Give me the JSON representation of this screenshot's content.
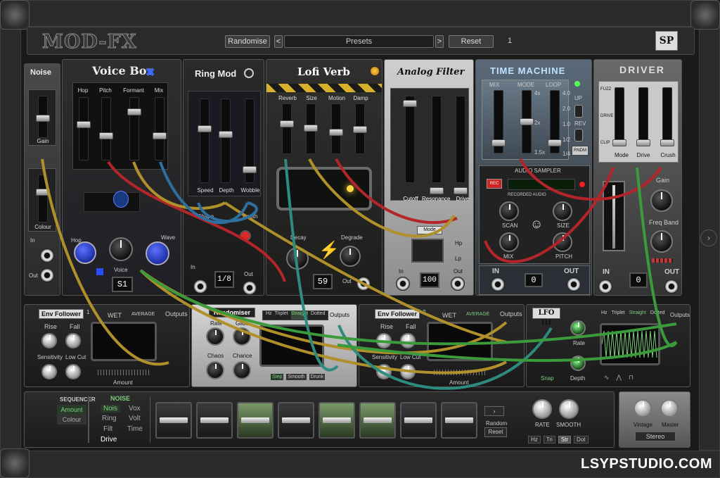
{
  "topbar": {
    "logo": "MOD-FX",
    "randomise_label": "Randomise",
    "preset_prev": "<",
    "preset_label": "Presets",
    "preset_next": ">",
    "reset_label": "Reset",
    "indicator": "1",
    "brand": "SP"
  },
  "noise": {
    "title": "Noise",
    "gain": "Gain",
    "colour": "Colour",
    "in": "In",
    "out": "Out"
  },
  "voicebox": {
    "title": "Voice Box",
    "sliders": [
      "Hop",
      "Pitch",
      "Formant",
      "Mix"
    ],
    "knob_voice": "Voice",
    "knob_wave": "Wave",
    "display": "S1"
  },
  "ringmod": {
    "title": "Ring Mod",
    "sliders": [
      "Speed",
      "Depth",
      "Wobble"
    ],
    "labels": [
      "Shape",
      "Depth"
    ],
    "display": "1/8",
    "in": "In",
    "out": "Out"
  },
  "lofiverb": {
    "title": "Lofi Verb",
    "sliders": [
      "Reverb",
      "Size",
      "Motion",
      "Damp"
    ],
    "knob_decay": "Decay",
    "knob_degrade": "Degrade",
    "display": "59",
    "out": "Out"
  },
  "analogfilter": {
    "title": "Analog Filter",
    "sliders": [
      "Cutoff",
      "Resonance",
      "Drive"
    ],
    "mode": "Mode",
    "hp": "Hp",
    "lp": "Lp",
    "display": "100",
    "in": "In",
    "out": "Out"
  },
  "timemachine": {
    "title": "TIME MACHINE",
    "cols": [
      "MIX",
      "MODE",
      "LOOP"
    ],
    "mode_vals": [
      "4x",
      "2x",
      "1.5x"
    ],
    "loop_vals": [
      "4.0",
      "2.0",
      "1.0",
      "1/2",
      "1/4"
    ],
    "switches": [
      "UP",
      "REV",
      "RNDM"
    ],
    "sampler": "AUDIO SAMPLER",
    "rec": "REC",
    "recorded": "RECORDED AUDIO",
    "knobs": [
      "SCAN",
      "SIZE",
      "MIX",
      "PITCH"
    ],
    "in": "IN",
    "out": "OUT",
    "display": "0"
  },
  "driver": {
    "title": "DRIVER",
    "sliders": [
      "Mode",
      "Drive",
      "Crush"
    ],
    "side": [
      "FUZZ",
      "DRIVE",
      "CLIP"
    ],
    "gain": "Gain",
    "freqband": "Freq Band",
    "in": "IN",
    "out": "OUT",
    "display": "0"
  },
  "envfollower1": {
    "title": "Env Follower",
    "num": "1",
    "wet": "WET",
    "average": "AVERAGE",
    "outputs": "Outputs",
    "rise": "Rise",
    "fall": "Fall",
    "sensitivity": "Sensitivity",
    "lowcut": "Low Cut",
    "amount": "Amount"
  },
  "randomiser": {
    "title": "Randomiser",
    "tabs": [
      "Hz",
      "Triplet",
      "Straight",
      "Dotted"
    ],
    "rate": "Rate",
    "glide": "Glide",
    "chaos": "Chaos",
    "chance": "Chance",
    "modes": [
      "Step",
      "Smooth",
      "Drunk"
    ],
    "outputs": "Outputs"
  },
  "envfollower2": {
    "title": "Env Follower",
    "num": "2",
    "wet": "WET",
    "average": "AVERAGE",
    "outputs": "Outputs",
    "rise": "Rise",
    "fall": "Fall",
    "sensitivity": "Sensitivity",
    "lowcut": "Low Cut",
    "amount": "Amount"
  },
  "lfo": {
    "title": "LFO III",
    "tabs": [
      "Hz",
      "Triplet",
      "Straight",
      "Dotted"
    ],
    "rate": "Rate",
    "depth": "Depth",
    "snap": "Snap",
    "outputs": "Outputs"
  },
  "sequencer": {
    "header": "SEQUENCER",
    "items": [
      "Amount",
      "Colour"
    ],
    "noise_header": "NOISE",
    "noise_items": [
      "Nois",
      "Vox",
      "Ring",
      "Volt",
      "Filt",
      "Time",
      "Drive"
    ],
    "random": "Random",
    "reset": "Reset",
    "rate": "RATE",
    "smooth": "SMOOTH",
    "modes": [
      "Hz",
      "Tri",
      "Str",
      "Dot"
    ],
    "steps": [
      0.5,
      0.5,
      0.5,
      0.5,
      0.5,
      0.5,
      0.5,
      0.5
    ]
  },
  "master": {
    "vintage": "Vintage",
    "master": "Master",
    "stereo": "Stereo"
  },
  "watermark": "LSYPSTUDIO.COM",
  "colors": {
    "cable_red": "#b3252a",
    "cable_yellow": "#b0902a",
    "cable_blue": "#2f6fa0",
    "cable_teal": "#2f8a80",
    "cable_green": "#3b9a3b",
    "accent_green": "#7ecf7e"
  }
}
